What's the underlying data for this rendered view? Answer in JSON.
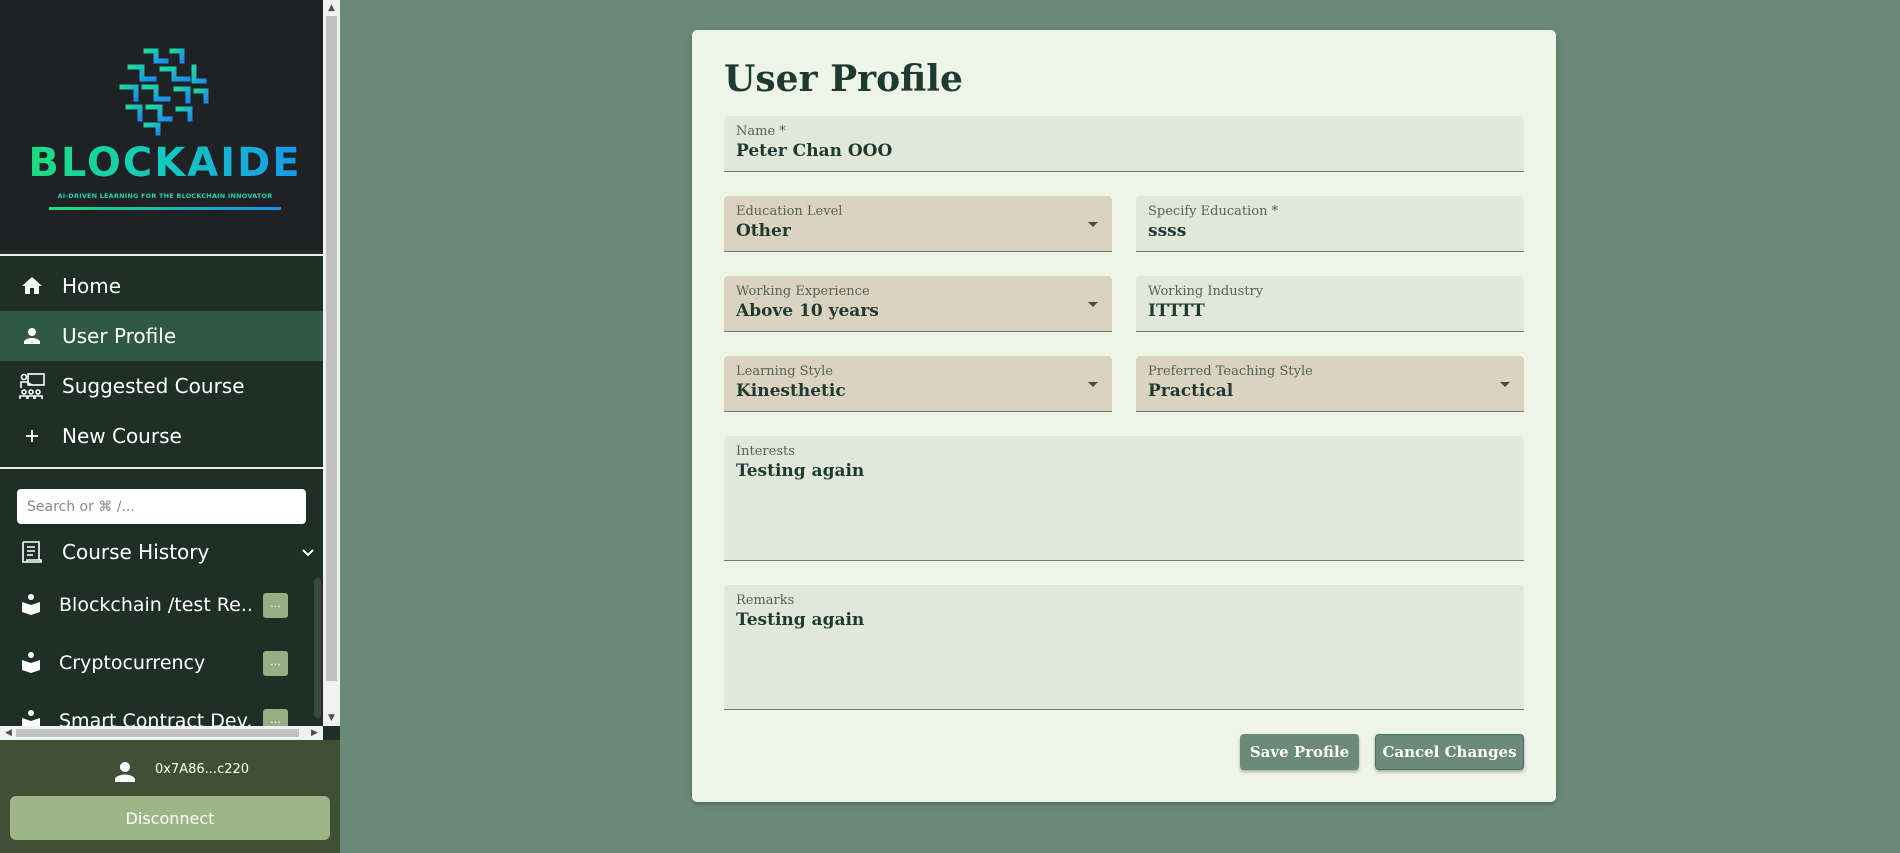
{
  "brand": {
    "name": "BLOCKAIDE",
    "tagline": "AI-DRIVEN LEARNING FOR THE BLOCKCHAIN INNOVATOR"
  },
  "nav": [
    {
      "label": "Home",
      "icon": "home-icon"
    },
    {
      "label": "User Profile",
      "icon": "person-icon",
      "active": true
    },
    {
      "label": "Suggested Course",
      "icon": "teacher-icon"
    },
    {
      "label": "New Course",
      "icon": "plus-icon"
    }
  ],
  "search": {
    "placeholder": "Search or ⌘ /..."
  },
  "history": {
    "label": "Course History",
    "items": [
      {
        "label": "Blockchain /test Re...",
        "more": "..."
      },
      {
        "label": "Cryptocurrency",
        "more": "..."
      },
      {
        "label": "Smart Contract Dev...",
        "more": "..."
      }
    ]
  },
  "user": {
    "wallet": "0x7A86...c220",
    "disconnect_label": "Disconnect"
  },
  "profile": {
    "title": "User Profile",
    "name": {
      "label": "Name *",
      "value": "Peter Chan OOO"
    },
    "education_level": {
      "label": "Education Level",
      "value": "Other"
    },
    "specify_education": {
      "label": "Specify Education *",
      "value": "ssss"
    },
    "working_experience": {
      "label": "Working Experience",
      "value": "Above 10 years"
    },
    "working_industry": {
      "label": "Working Industry",
      "value": "ITTTT"
    },
    "learning_style": {
      "label": "Learning Style",
      "value": "Kinesthetic"
    },
    "teaching_style": {
      "label": "Preferred Teaching Style",
      "value": "Practical"
    },
    "interests": {
      "label": "Interests",
      "value": "Testing again"
    },
    "remarks": {
      "label": "Remarks",
      "value": "Testing again"
    },
    "save_label": "Save Profile",
    "cancel_label": "Cancel Changes"
  },
  "colors": {
    "background": "#6b8a7a",
    "sidebar": "#1f2e26",
    "active_nav": "#2f5845",
    "card": "#eff5e6",
    "text_field": "#e1e8d9",
    "select_field": "#dbd3bf",
    "accent_button": "#9db587"
  }
}
